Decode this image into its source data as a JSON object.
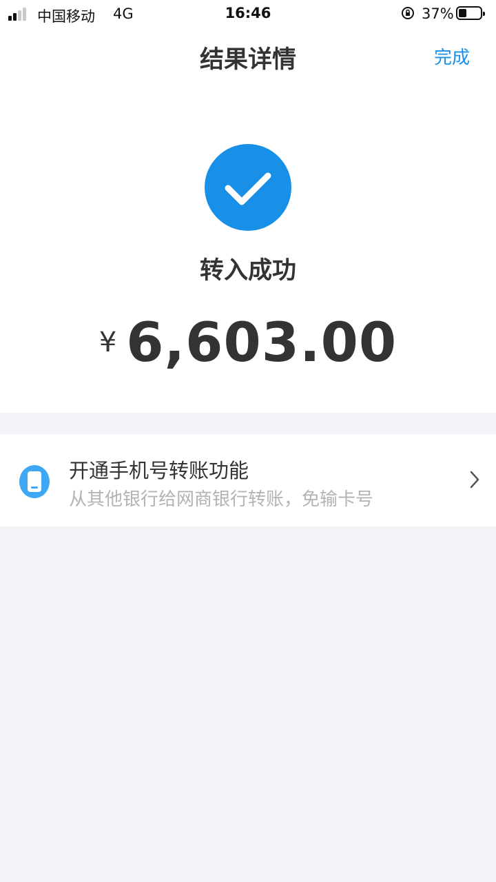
{
  "status_bar": {
    "carrier": "中国移动",
    "network": "4G",
    "time": "16:46",
    "battery_percent": "37%",
    "signal_bars_active": 2,
    "signal_bars_total": 4,
    "battery_level": 0.37
  },
  "nav": {
    "title": "结果详情",
    "done_label": "完成"
  },
  "result": {
    "status_text": "转入成功",
    "currency_symbol": "¥",
    "amount": "6,603.00"
  },
  "promo": {
    "title": "开通手机号转账功能",
    "subtitle": "从其他银行给网商银行转账，免输卡号"
  },
  "colors": {
    "accent": "#1890e8",
    "icon_blue": "#3fa8f5",
    "background": "#f2f2f7"
  }
}
